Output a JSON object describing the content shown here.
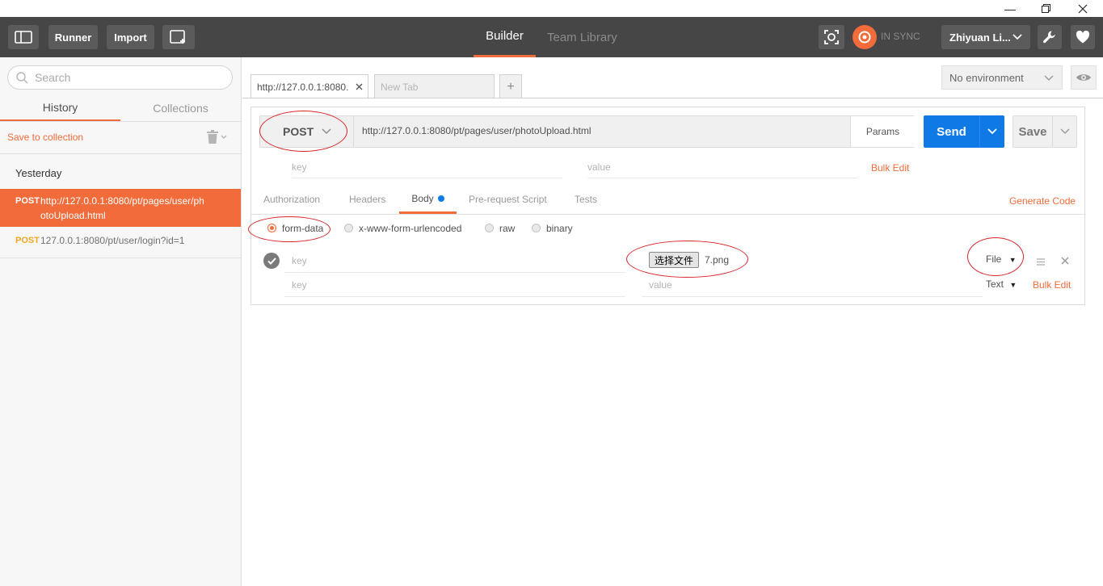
{
  "header": {
    "runner_label": "Runner",
    "import_label": "Import",
    "tab_builder": "Builder",
    "tab_team_library": "Team Library",
    "sync_status": "IN SYNC",
    "user_name": "Zhiyuan Li..."
  },
  "sidebar": {
    "search_placeholder": "Search",
    "tab_history": "History",
    "tab_collections": "Collections",
    "save_to_collection": "Save to collection",
    "group_label": "Yesterday",
    "items": [
      {
        "method": "POST",
        "url_line1": "http://127.0.0.1:8080/pt/pages/user/ph",
        "url_line2": "otoUpload.html"
      },
      {
        "method": "POST",
        "url_line1": "127.0.0.1:8080/pt/user/login?id=1"
      }
    ]
  },
  "main": {
    "tabs": [
      {
        "label": "http://127.0.0.1:8080."
      },
      {
        "label": "New Tab"
      }
    ],
    "environment": "No environment",
    "method": "POST",
    "url": "http://127.0.0.1:8080/pt/pages/user/photoUpload.html",
    "params_label": "Params",
    "send_label": "Send",
    "save_label": "Save",
    "param_key_placeholder": "key",
    "param_value_placeholder": "value",
    "bulk_edit": "Bulk Edit",
    "request_tabs": [
      "Authorization",
      "Headers",
      "Body",
      "Pre-request Script",
      "Tests"
    ],
    "generate_code": "Generate Code",
    "body_modes": [
      "form-data",
      "x-www-form-urlencoded",
      "raw",
      "binary"
    ],
    "form_rows": [
      {
        "key_placeholder": "key",
        "file_button": "选择文件",
        "file_name": "7.png",
        "type": "File"
      },
      {
        "key_placeholder": "key",
        "value_placeholder": "value",
        "type": "Text"
      }
    ],
    "form_bulk_edit": "Bulk Edit"
  },
  "colors": {
    "accent": "#f26b3a",
    "send_blue": "#0f7ae5",
    "topbar": "#464646"
  }
}
